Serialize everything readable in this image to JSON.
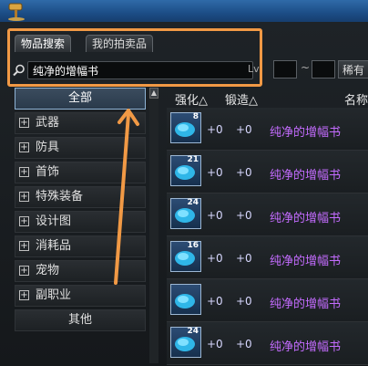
{
  "tabs": [
    {
      "label": "物品搜索",
      "active": true
    },
    {
      "label": "我的拍卖品",
      "active": false
    }
  ],
  "search": {
    "value": "纯净的增幅书"
  },
  "filters": {
    "level_label": "Lv",
    "tilde": "~",
    "rarity_label": "稀有"
  },
  "categories": [
    {
      "label": "全部",
      "expandable": false,
      "selected": true
    },
    {
      "label": "武器",
      "expandable": true
    },
    {
      "label": "防具",
      "expandable": true
    },
    {
      "label": "首饰",
      "expandable": true
    },
    {
      "label": "特殊装备",
      "expandable": true
    },
    {
      "label": "设计图",
      "expandable": true
    },
    {
      "label": "消耗品",
      "expandable": true
    },
    {
      "label": "宠物",
      "expandable": true
    },
    {
      "label": "副职业",
      "expandable": true
    },
    {
      "label": "其他",
      "expandable": false
    }
  ],
  "columns": {
    "enhance": "强化△",
    "forge": "锻造△",
    "name": "名称"
  },
  "results": [
    {
      "count": "8",
      "enhance": "+0",
      "forge": "+0",
      "name": "纯净的增幅书"
    },
    {
      "count": "21",
      "enhance": "+0",
      "forge": "+0",
      "name": "纯净的增幅书"
    },
    {
      "count": "24",
      "enhance": "+0",
      "forge": "+0",
      "name": "纯净的增幅书"
    },
    {
      "count": "16",
      "enhance": "+0",
      "forge": "+0",
      "name": "纯净的增幅书"
    },
    {
      "count": "",
      "enhance": "+0",
      "forge": "+0",
      "name": "纯净的增幅书"
    },
    {
      "count": "24",
      "enhance": "+0",
      "forge": "+0",
      "name": "纯净的增幅书"
    }
  ],
  "colors": {
    "highlight": "#f19945",
    "item_name": "#c46cff"
  }
}
